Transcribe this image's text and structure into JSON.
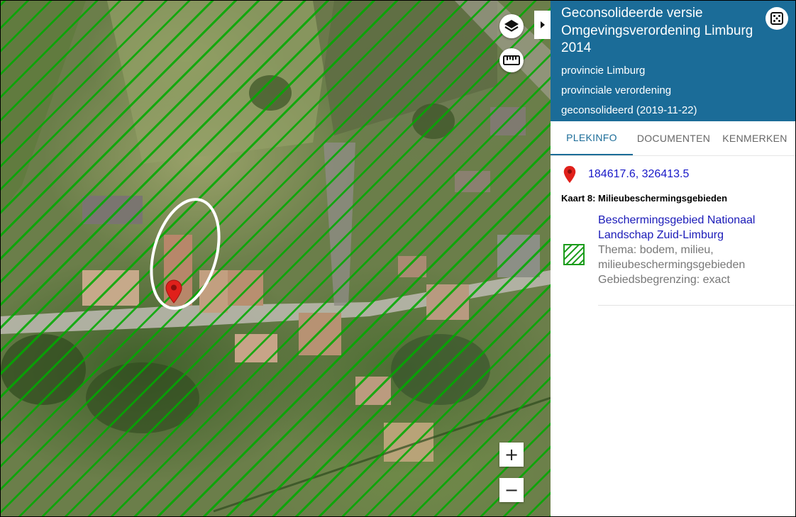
{
  "map": {
    "layers_icon": "layers-icon",
    "measure_icon": "ruler-icon",
    "zoom_in_label": "+",
    "zoom_out_label": "−",
    "toggle_icon": "caret-right-icon"
  },
  "panel": {
    "title": "Geconsolideerde versie Omgevingsverordening Limburg 2014",
    "meta": [
      "provincie Limburg",
      "provinciale verordening",
      "geconsolideerd (2019-11-22)"
    ],
    "dice_icon": "dice-icon",
    "tabs": [
      {
        "label": "PLEKINFO",
        "active": true
      },
      {
        "label": "DOCUMENTEN",
        "active": false
      },
      {
        "label": "KENMERKEN",
        "active": false
      }
    ],
    "coordinates": "184617.6, 326413.5",
    "kaart_title": "Kaart 8: Milieubeschermingsgebieden",
    "entry": {
      "link": "Beschermingsgebied Nationaal Landschap Zuid-Limburg",
      "thema": "Thema: bodem, milieu, milieubeschermingsgebieden",
      "begrenzing": "Gebiedsbegrenzing: exact"
    }
  },
  "colors": {
    "header_bg": "#1b6c98",
    "link": "#1a1ab8",
    "hatch": "#00aa00",
    "marker": "#e0201b"
  }
}
